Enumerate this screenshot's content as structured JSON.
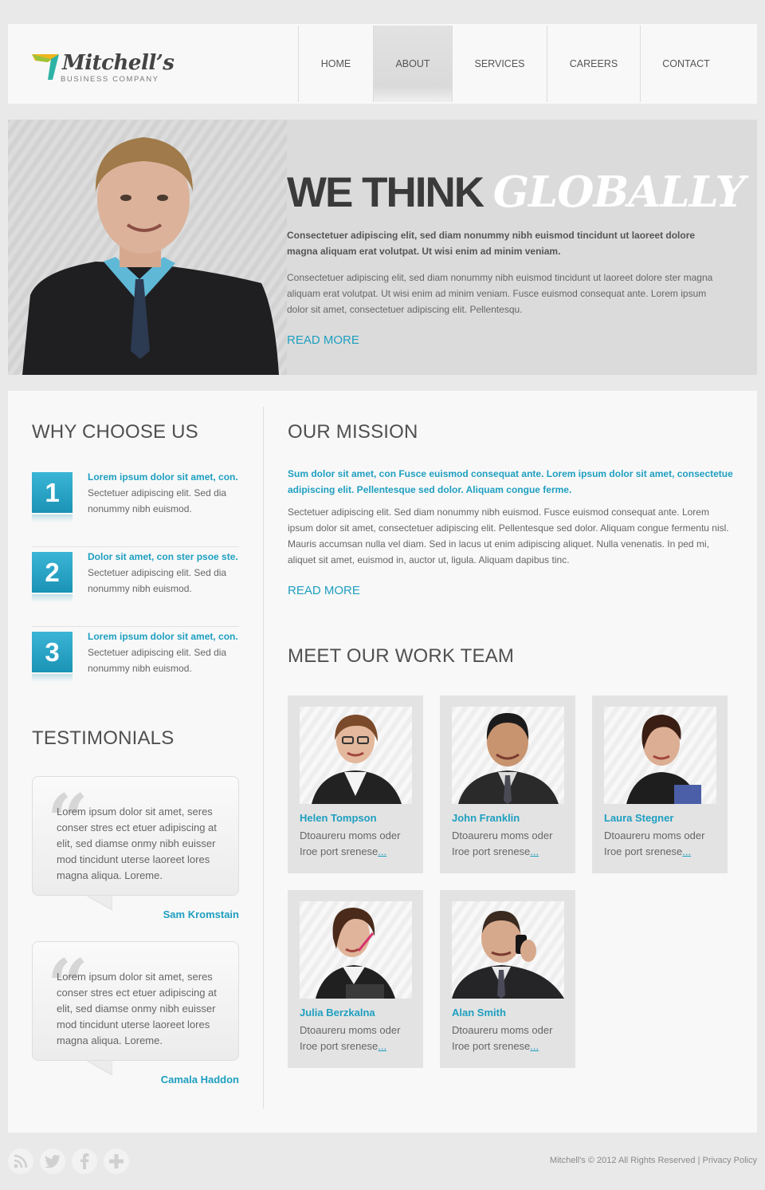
{
  "brand": {
    "name": "Mitchell’s",
    "tagline": "BUSINESS COMPANY",
    "colors": {
      "accent": "#1e9fc0",
      "logo_yellow": "#f2b51c",
      "logo_teal": "#2db3a6"
    }
  },
  "nav": {
    "items": [
      {
        "label": "HOME",
        "active": false
      },
      {
        "label": "ABOUT",
        "active": true
      },
      {
        "label": "SERVICES",
        "active": false
      },
      {
        "label": "CAREERS",
        "active": false
      },
      {
        "label": "CONTACT",
        "active": false
      }
    ]
  },
  "hero": {
    "title_plain": "WE THINK",
    "title_emphasis": "GLOBALLY",
    "lead": "Consectetuer adipiscing elit, sed diam nonummy nibh euismod tincidunt ut laoreet dolore magna aliquam erat volutpat. Ut wisi enim ad minim veniam.",
    "body": "Consectetuer adipiscing elit, sed diam nonummy nibh euismod tincidunt ut laoreet dolore ster magna aliquam erat volutpat. Ut wisi enim ad minim veniam. Fusce euismod consequat ante. Lorem ipsum dolor sit amet, consectetuer adipiscing elit. Pellentesqu.",
    "read_more": "READ MORE"
  },
  "why": {
    "heading": "WHY CHOOSE US",
    "items": [
      {
        "number": "1",
        "title": "Lorem ipsum dolor sit amet, con.",
        "text": "Sectetuer adipiscing elit. Sed dia nonummy nibh euismod."
      },
      {
        "number": "2",
        "title": "Dolor sit amet, con ster psoe ste.",
        "text": "Sectetuer adipiscing elit. Sed dia nonummy nibh euismod."
      },
      {
        "number": "3",
        "title": "Lorem ipsum dolor sit amet, con.",
        "text": "Sectetuer adipiscing elit. Sed dia nonummy nibh euismod."
      }
    ]
  },
  "testimonials": {
    "heading": "TESTIMONIALS",
    "items": [
      {
        "text": "Lorem ipsum dolor sit amet, seres conser stres ect etuer adipiscing at elit, sed diamse onmy nibh euisser mod tincidunt uterse laoreet lores magna aliqua. Loreme.",
        "author": "Sam Kromstain"
      },
      {
        "text": "Lorem ipsum dolor sit amet, seres conser stres ect etuer adipiscing at elit, sed diamse onmy nibh euisser mod tincidunt uterse laoreet lores magna aliqua. Loreme.",
        "author": "Camala Haddon"
      }
    ]
  },
  "mission": {
    "heading": "OUR MISSION",
    "lead": "Sum dolor sit amet, con Fusce euismod consequat ante. Lorem ipsum dolor sit amet, consectetue adipiscing elit. Pellentesque sed dolor. Aliquam congue ferme.",
    "body": "Sectetuer adipiscing elit. Sed diam nonummy nibh euismod. Fusce euismod consequat ante. Lorem ipsum dolor sit amet, consectetuer adipiscing elit. Pellentesque sed dolor. Aliquam congue fermentu nisl. Mauris accumsan nulla vel diam. Sed in lacus ut enim adipiscing aliquet. Nulla venenatis. In ped mi, aliquet sit amet, euismod in, auctor ut, ligula. Aliquam dapibus tinc.",
    "read_more": "READ MORE"
  },
  "team": {
    "heading": "MEET OUR WORK TEAM",
    "members": [
      {
        "name": "Helen Tompson",
        "desc": "Dtoaureru moms oder Iroe port srenese",
        "more": "..."
      },
      {
        "name": "John Franklin",
        "desc": "Dtoaureru moms oder Iroe port srenese",
        "more": "..."
      },
      {
        "name": "Laura Stegner",
        "desc": "Dtoaureru moms oder Iroe port srenese",
        "more": "..."
      },
      {
        "name": "Julia Berzkalna",
        "desc": "Dtoaureru moms oder Iroe port srenese",
        "more": "..."
      },
      {
        "name": "Alan Smith",
        "desc": "Dtoaureru moms oder Iroe port srenese",
        "more": "..."
      }
    ]
  },
  "footer": {
    "social_icons": [
      "rss-icon",
      "twitter-icon",
      "facebook-icon",
      "plus-icon"
    ],
    "copyright": "Mitchell's © 2012 All Rights Reserved",
    "separator": " | ",
    "privacy": "Privacy Policy"
  }
}
